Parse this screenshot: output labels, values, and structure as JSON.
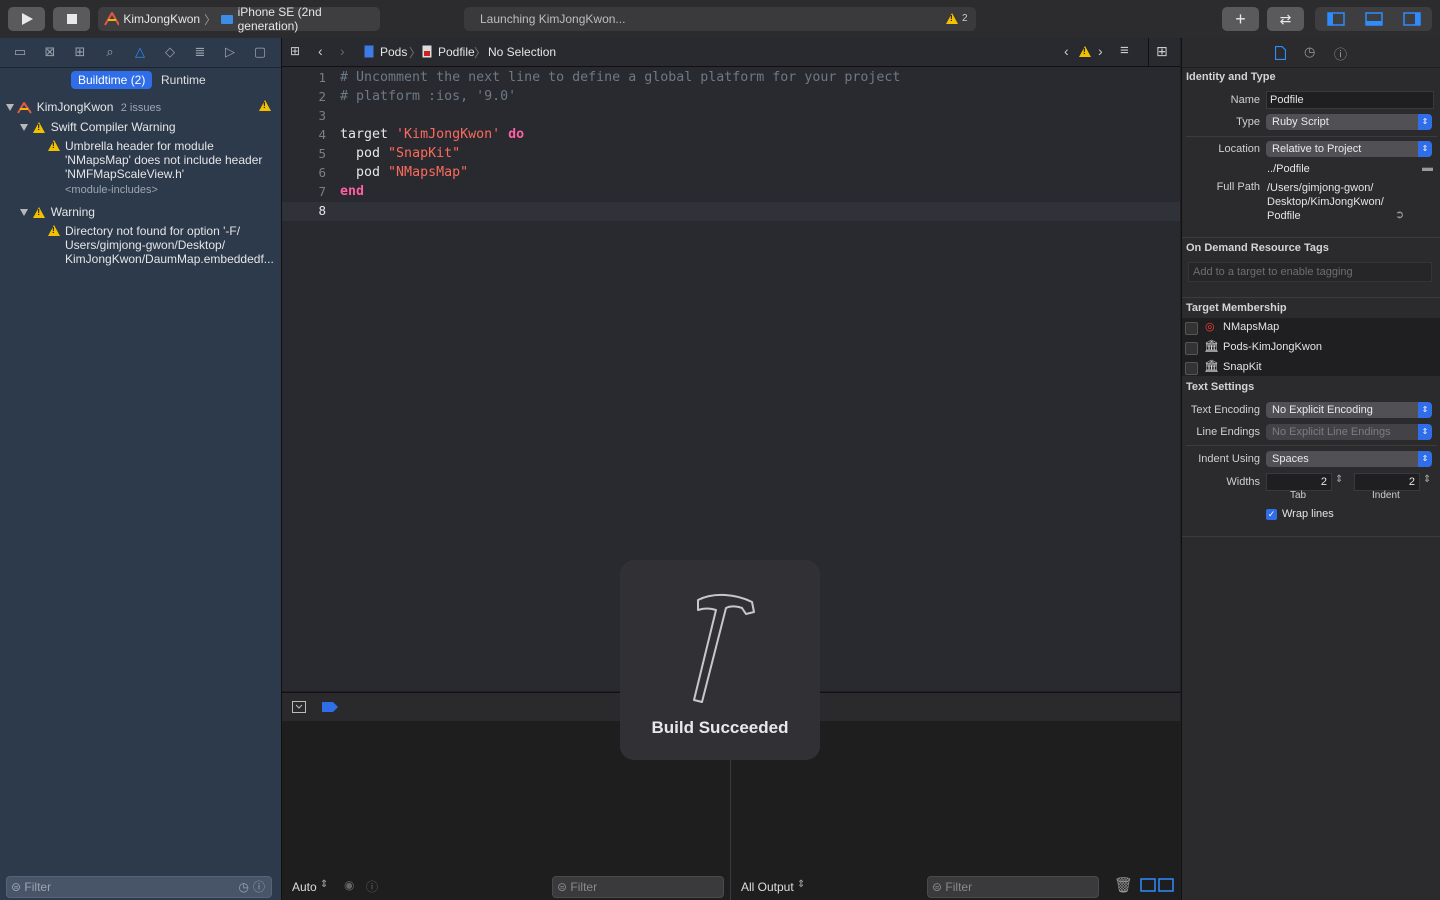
{
  "toolbar": {
    "scheme_name": "KimJongKwon",
    "device_name": "iPhone SE (2nd generation)",
    "activity_text": "Launching KimJongKwon...",
    "warning_count": "2"
  },
  "navigator": {
    "segments": {
      "buildtime": "Buildtime (2)",
      "runtime": "Runtime"
    },
    "project": {
      "name": "KimJongKwon",
      "issues": "2 issues"
    },
    "groups": [
      {
        "title": "Swift Compiler Warning",
        "items": [
          {
            "lines": [
              "Umbrella header for module",
              "'NMapsMap' does not include header",
              "'NMFMapScaleView.h'"
            ],
            "detail": "<module-includes>"
          }
        ]
      },
      {
        "title": "Warning",
        "items": [
          {
            "lines": [
              "Directory not found for option '-F/",
              "Users/gimjong-gwon/Desktop/",
              "KimJongKwon/DaumMap.embeddedf..."
            ]
          }
        ]
      }
    ],
    "filter_placeholder": "Filter"
  },
  "jumpbar": {
    "crumbs": [
      "Pods",
      "Podfile",
      "No Selection"
    ]
  },
  "editor": {
    "lines": [
      {
        "n": "1",
        "parts": [
          {
            "t": "# Uncomment the next line to define a global platform for your project",
            "c": "cmt"
          }
        ]
      },
      {
        "n": "2",
        "parts": [
          {
            "t": "# platform :ios, '9.0'",
            "c": "cmt"
          }
        ]
      },
      {
        "n": "3",
        "parts": []
      },
      {
        "n": "4",
        "parts": [
          {
            "t": "target ",
            "c": "plain"
          },
          {
            "t": "'KimJongKwon'",
            "c": "str"
          },
          {
            "t": " ",
            "c": "plain"
          },
          {
            "t": "do",
            "c": "kw"
          }
        ]
      },
      {
        "n": "5",
        "parts": [
          {
            "t": "  pod ",
            "c": "plain"
          },
          {
            "t": "\"SnapKit\"",
            "c": "str"
          }
        ]
      },
      {
        "n": "6",
        "parts": [
          {
            "t": "  pod ",
            "c": "plain"
          },
          {
            "t": "\"NMapsMap\"",
            "c": "str"
          }
        ]
      },
      {
        "n": "7",
        "parts": [
          {
            "t": "end",
            "c": "kw"
          }
        ]
      },
      {
        "n": "8",
        "parts": []
      }
    ],
    "current_line": "8"
  },
  "debug": {
    "auto_label": "Auto",
    "output_label": "All Output",
    "filter_placeholder": "Filter"
  },
  "hud": {
    "message": "Build Succeeded"
  },
  "inspector": {
    "identity": {
      "heading": "Identity and Type",
      "name_label": "Name",
      "name_value": "Podfile",
      "type_label": "Type",
      "type_value": "Ruby Script",
      "location_label": "Location",
      "location_value": "Relative to Project",
      "relative_path": "../Podfile",
      "full_path_label": "Full Path",
      "full_path_lines": [
        "/Users/gimjong-gwon/",
        "Desktop/KimJongKwon/",
        "Podfile"
      ]
    },
    "tags": {
      "heading": "On Demand Resource Tags",
      "placeholder": "Add to a target to enable tagging"
    },
    "membership": {
      "heading": "Target Membership",
      "targets": [
        "NMapsMap",
        "Pods-KimJongKwon",
        "SnapKit"
      ]
    },
    "text_settings": {
      "heading": "Text Settings",
      "encoding_label": "Text Encoding",
      "encoding_value": "No Explicit Encoding",
      "line_endings_label": "Line Endings",
      "line_endings_value": "No Explicit Line Endings",
      "indent_using_label": "Indent Using",
      "indent_using_value": "Spaces",
      "widths_label": "Widths",
      "tab_value": "2",
      "indent_value": "2",
      "tab_caption": "Tab",
      "indent_caption": "Indent",
      "wrap_label": "Wrap lines",
      "wrap_checked": true
    }
  },
  "colors": {
    "accent": "#2f6ee8",
    "warning": "#f2c200",
    "navigator_bg": "#2c3a4c",
    "editor_bg": "#292a2f"
  }
}
